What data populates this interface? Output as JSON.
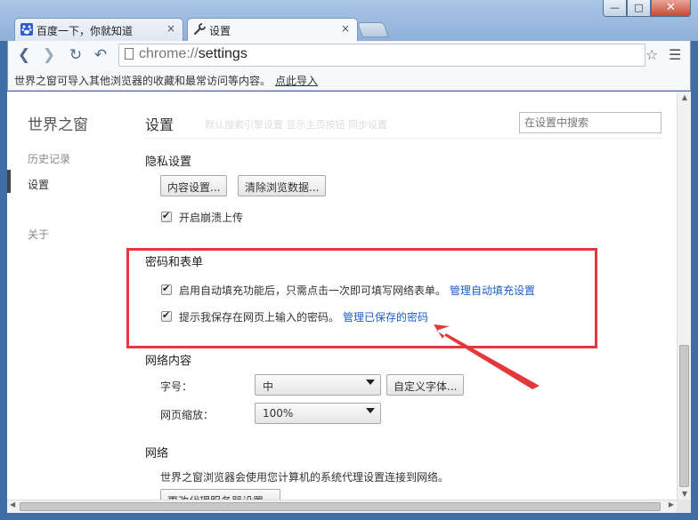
{
  "window": {
    "min": "—",
    "max": "□",
    "close": "✕"
  },
  "tabs": [
    {
      "title": "百度一下，你就知道",
      "close": "×"
    },
    {
      "title": "设置",
      "close": "×"
    }
  ],
  "toolbar": {
    "back": "❮",
    "forward": "❯",
    "reload": "↻",
    "undo": "↶",
    "url_scheme": "chrome://",
    "url_host": "settings",
    "star": "☆",
    "menu": "☰"
  },
  "bookmark_bar": {
    "text": "世界之窗可导入其他浏览器的收藏和最常访问等内容。",
    "link": "点此导入"
  },
  "sidebar": {
    "title": "世界之窗",
    "items": [
      {
        "label": "历史记录"
      },
      {
        "label": "设置"
      },
      {
        "label": "关于"
      }
    ]
  },
  "main": {
    "title": "设置",
    "ghost_text": "默认搜索引擎设置   显示主页按钮   同步设置",
    "search_placeholder": "在设置中搜索",
    "privacy": {
      "heading": "隐私设置",
      "content_settings_btn": "内容设置...",
      "clear_data_btn": "清除浏览数据...",
      "crash_upload_label": "开启崩溃上传"
    },
    "passwords": {
      "heading": "密码和表单",
      "autofill_label": "启用自动填充功能后，只需点击一次即可填写网络表单。",
      "autofill_link": "管理自动填充设置",
      "save_pw_label": "提示我保存在网页上输入的密码。",
      "save_pw_link": "管理已保存的密码"
    },
    "web_content": {
      "heading": "网络内容",
      "font_size_label": "字号：",
      "font_size_value": "中",
      "custom_fonts_btn": "自定义字体...",
      "zoom_label": "网页缩放：",
      "zoom_value": "100%"
    },
    "network": {
      "heading": "网络",
      "desc": "世界之窗浏览器会使用您计算机的系统代理设置连接到网络。",
      "proxy_btn": "更改代理服务器设置..."
    }
  },
  "colors": {
    "highlight_box": "#e23a3a",
    "arrow": "#e23a3a",
    "link": "#1a5ecb"
  }
}
